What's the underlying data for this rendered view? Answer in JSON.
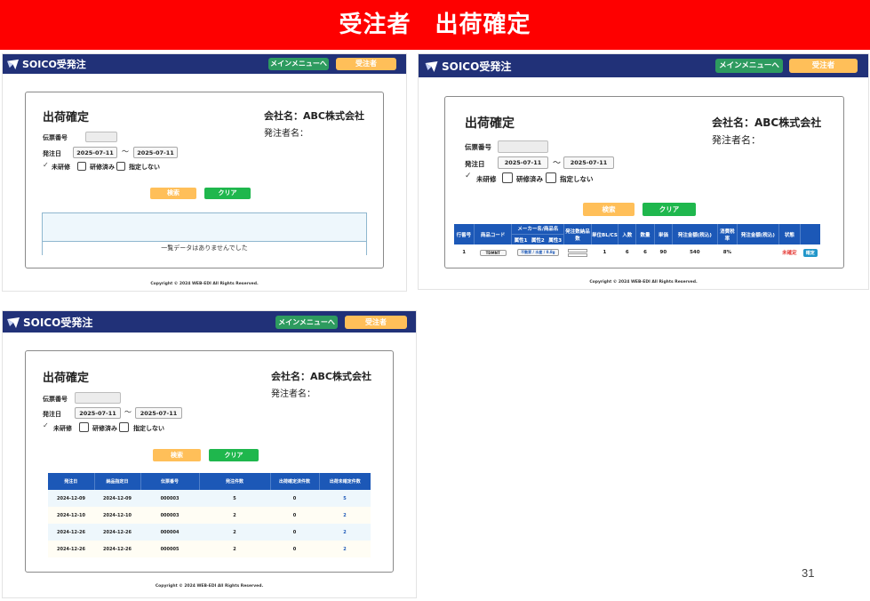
{
  "slide_title": "受注者　出荷確定",
  "page_number": "31",
  "common": {
    "brand": "SOICO",
    "brand_suffix": "受発注",
    "menu_button": "メインメニューへ",
    "order_button": "受注者",
    "page_title": "出荷確定",
    "company_label": "会社名：ABC株式会社",
    "orderer_label": "発注者名：",
    "slip_label": "伝票番号",
    "order_date_label": "発注日",
    "date_from": "2025-07-11",
    "date_tilde": "～",
    "date_to": "2025-07-11",
    "filters": [
      {
        "label": "未研修",
        "checked": true
      },
      {
        "label": "研修済み",
        "checked": false
      },
      {
        "label": "指定しない",
        "checked": false
      }
    ],
    "search_button": "検索",
    "clear_button": "クリア",
    "copyright": "Copyright © 2024 WEB-EDI All Rights Reserved."
  },
  "panel1": {
    "empty_message": "一覧データはありませんでした"
  },
  "panel2": {
    "headers": [
      "行番号",
      "商品コード",
      "メーカー名/商品名",
      "発注数納品数",
      "単位BL/CS",
      "入数",
      "数量",
      "単価",
      "発注金額(税込)",
      "消費税率",
      "発注金額(税込)",
      "状態",
      ""
    ],
    "subheaders": [
      "属性1",
      "属性2",
      "属性3"
    ],
    "row": {
      "line": "1",
      "code": "TDMNT",
      "name": "不動家 / 水産 / 0.8g",
      "unit": "1",
      "irisu": "6",
      "qty": "6",
      "price": "90",
      "amount": "540",
      "tax": "8%",
      "status": "未確定",
      "action": "確定"
    }
  },
  "panel3": {
    "headers": [
      "発注日",
      "納品指定日",
      "伝票番号",
      "発注件数",
      "出荷確定済件数",
      "出荷未確定件数"
    ],
    "rows": [
      [
        "2024-12-09",
        "2024-12-09",
        "000003",
        "5",
        "0",
        "5"
      ],
      [
        "2024-12-10",
        "2024-12-10",
        "000003",
        "2",
        "0",
        "2"
      ],
      [
        "2024-12-26",
        "2024-12-26",
        "000004",
        "2",
        "0",
        "2"
      ],
      [
        "2024-12-26",
        "2024-12-26",
        "000005",
        "2",
        "0",
        "2"
      ]
    ]
  },
  "colors": {
    "banner": "#fe0000",
    "header": "#213178",
    "menu_button": "#2d9b5f",
    "order_button": "#ffbf59",
    "table_header": "#1c58b7",
    "link": "#1c58b7",
    "status_unconfirmed": "#e53935",
    "confirm_button": "#2196c9"
  }
}
